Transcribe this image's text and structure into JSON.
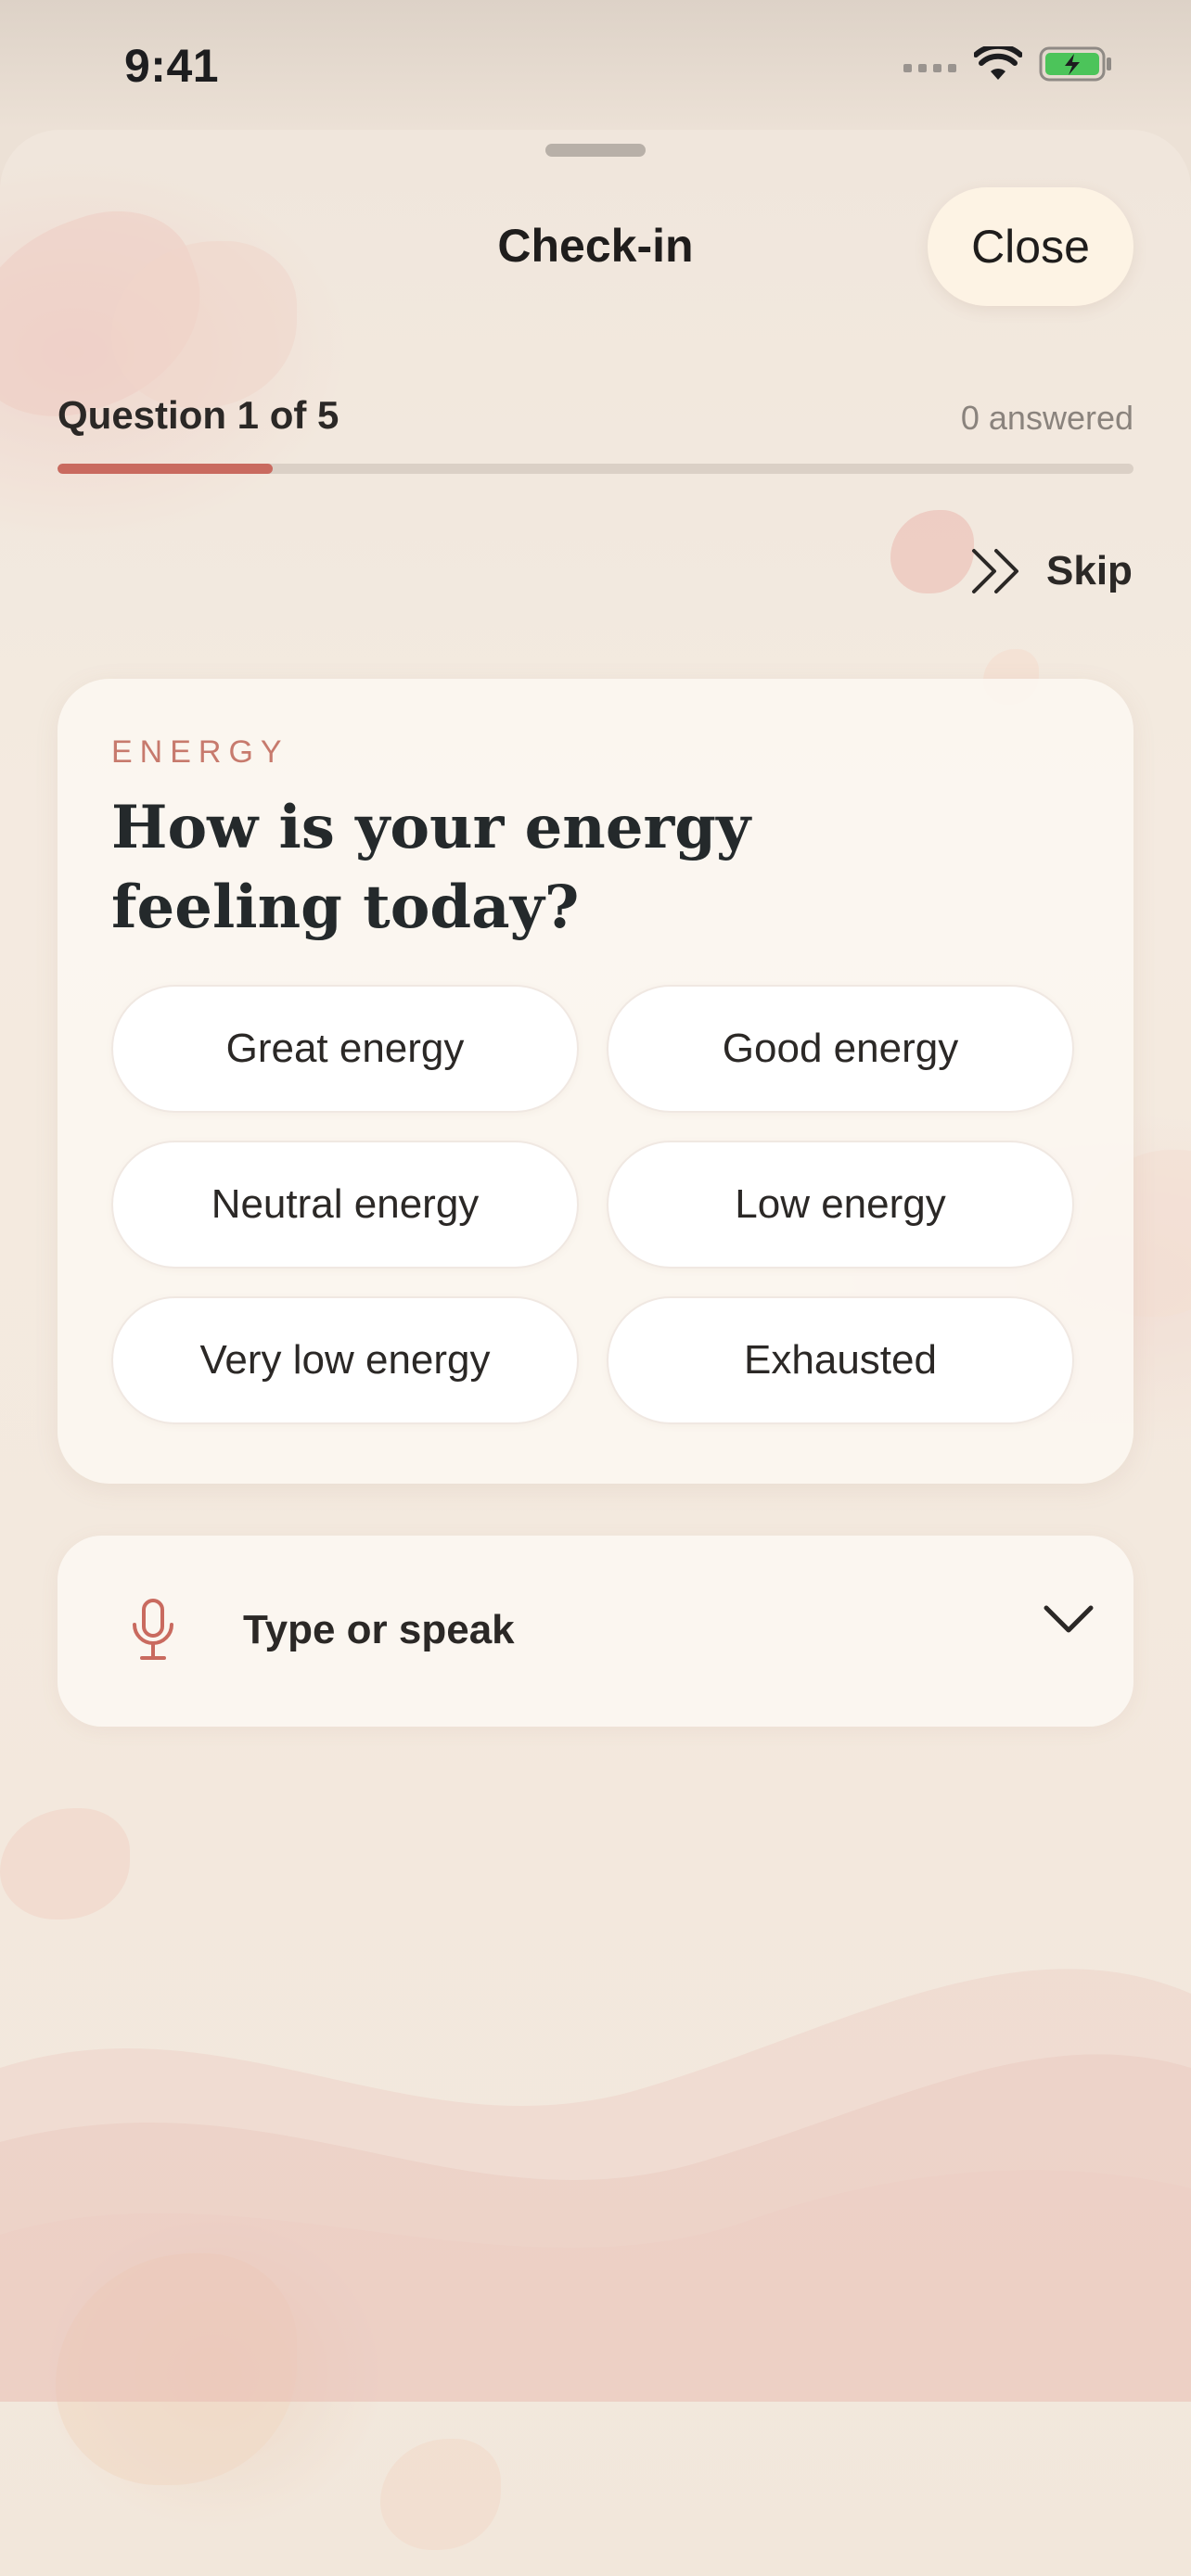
{
  "status_bar": {
    "time": "9:41"
  },
  "header": {
    "title": "Check-in",
    "close_label": "Close"
  },
  "progress": {
    "label": "Question 1 of 5",
    "answered": "0 answered",
    "fraction": 0.2
  },
  "skip": {
    "label": "Skip"
  },
  "question_card": {
    "category": "ENERGY",
    "question": "How is your energy feeling today?",
    "options": [
      "Great energy",
      "Good energy",
      "Neutral energy",
      "Low energy",
      "Very low energy",
      "Exhausted"
    ]
  },
  "input": {
    "placeholder": "Type or speak"
  },
  "colors": {
    "accent": "#c96a5f",
    "card": "#fcf7f1",
    "close_button": "#fdf3e4"
  },
  "icons": [
    "mic-icon",
    "chevron-down-icon",
    "skip-icon",
    "wifi-icon",
    "battery-icon",
    "signal-icon"
  ]
}
